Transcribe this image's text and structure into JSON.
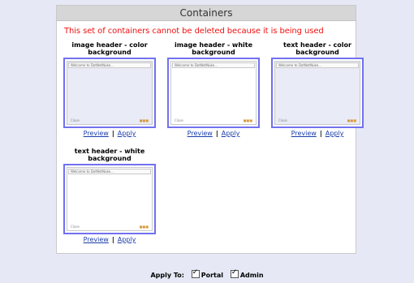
{
  "panel": {
    "title": "Containers",
    "warning": "This set of containers cannot be deleted because it is being used"
  },
  "containers": [
    {
      "title": "image header - color background",
      "style": "colored",
      "preview_label": "Preview",
      "apply_label": "Apply",
      "thumb_title": "Welcome to DotNetNuke...",
      "thumb_footer": "Close"
    },
    {
      "title": "image header - white background",
      "style": "white",
      "preview_label": "Preview",
      "apply_label": "Apply",
      "thumb_title": "Welcome to DotNetNuke...",
      "thumb_footer": "Close"
    },
    {
      "title": "text header - color background",
      "style": "colored",
      "preview_label": "Preview",
      "apply_label": "Apply",
      "thumb_title": "Welcome to DotNetNuke...",
      "thumb_footer": "Close"
    },
    {
      "title": "text header - white background",
      "style": "white",
      "preview_label": "Preview",
      "apply_label": "Apply",
      "thumb_title": "Welcome to DotNetNuke...",
      "thumb_footer": "Close"
    }
  ],
  "apply_to": {
    "label": "Apply To:",
    "portal_label": "Portal",
    "portal_checked": true,
    "admin_label": "Admin",
    "admin_checked": true
  },
  "colors": {
    "warning": "#ee1111",
    "thumb_border": "#7171f0",
    "link": "#1a3caa",
    "page_bg": "#e6e9f5"
  }
}
